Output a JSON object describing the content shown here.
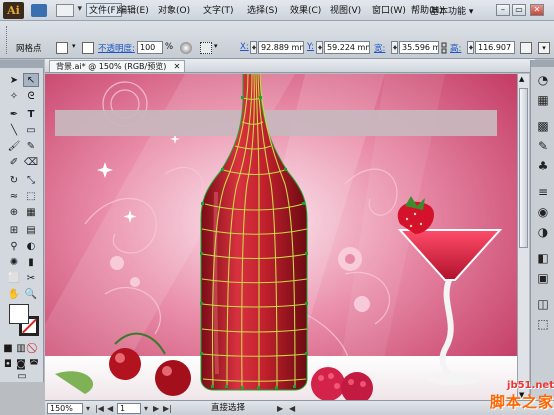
{
  "app": {
    "logo_text": "Ai",
    "menus": [
      "文件(F)",
      "编辑(E)",
      "对象(O)",
      "文字(T)",
      "选择(S)",
      "效果(C)",
      "视图(V)",
      "窗口(W)",
      "帮助(H)"
    ],
    "workspace_label": "基本功能"
  },
  "control_bar": {
    "mode_label": "网格点",
    "opacity_label": "不透明度:",
    "opacity_value": "100",
    "opacity_unit": "%",
    "x_label": "X:",
    "x_value": "92.889 mm",
    "y_label": "Y:",
    "y_value": "59.224 mm",
    "w_label": "宽:",
    "w_value": "35.596 mm",
    "h_label": "高:",
    "h_value": "116.907 mr"
  },
  "document": {
    "tab_label": "背景.ai* @ 150% (RGB/预览)",
    "tab_close": "✕"
  },
  "status_bar": {
    "zoom": "150%",
    "page": "1",
    "tool_status": "直接选择"
  },
  "watermark": {
    "site": "jb51.net",
    "name": "脚本之家"
  },
  "colors": {
    "accent": "#c2185b",
    "background_pink": "#e26a8c",
    "bottle_red": "#c1202d",
    "mesh_lines": "#c9d84a",
    "anchor_points": "#1ea531"
  }
}
